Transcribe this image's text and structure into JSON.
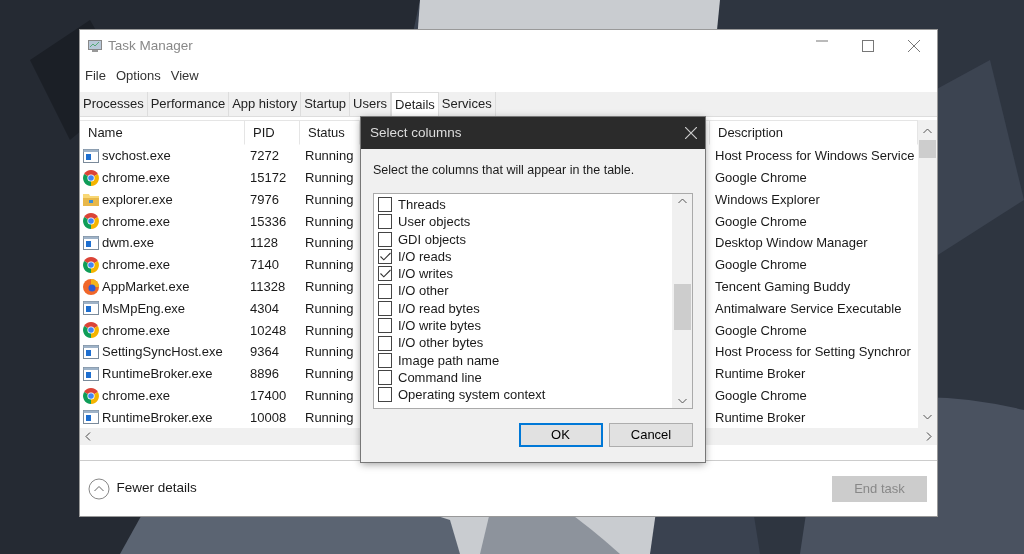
{
  "window": {
    "title": "Task Manager"
  },
  "menu": [
    "File",
    "Options",
    "View"
  ],
  "tabs": [
    {
      "label": "Processes",
      "selected": false
    },
    {
      "label": "Performance",
      "selected": false
    },
    {
      "label": "App history",
      "selected": false
    },
    {
      "label": "Startup",
      "selected": false
    },
    {
      "label": "Users",
      "selected": false
    },
    {
      "label": "Details",
      "selected": true
    },
    {
      "label": "Services",
      "selected": false
    }
  ],
  "table": {
    "columns": [
      "Name",
      "PID",
      "Status",
      "Description"
    ],
    "rows": [
      {
        "kind": "service",
        "name": "svchost.exe",
        "pid": "7272",
        "status": "Running",
        "description": "Host Process for Windows Service"
      },
      {
        "kind": "chrome",
        "name": "chrome.exe",
        "pid": "15172",
        "status": "Running",
        "description": "Google Chrome"
      },
      {
        "kind": "explorer",
        "name": "explorer.exe",
        "pid": "7976",
        "status": "Running",
        "description": "Windows Explorer"
      },
      {
        "kind": "chrome",
        "name": "chrome.exe",
        "pid": "15336",
        "status": "Running",
        "description": "Google Chrome"
      },
      {
        "kind": "service",
        "name": "dwm.exe",
        "pid": "1128",
        "status": "Running",
        "description": "Desktop Window Manager"
      },
      {
        "kind": "chrome",
        "name": "chrome.exe",
        "pid": "7140",
        "status": "Running",
        "description": "Google Chrome"
      },
      {
        "kind": "appmarket",
        "name": "AppMarket.exe",
        "pid": "11328",
        "status": "Running",
        "description": "Tencent Gaming Buddy"
      },
      {
        "kind": "service",
        "name": "MsMpEng.exe",
        "pid": "4304",
        "status": "Running",
        "description": "Antimalware Service Executable"
      },
      {
        "kind": "chrome",
        "name": "chrome.exe",
        "pid": "10248",
        "status": "Running",
        "description": "Google Chrome"
      },
      {
        "kind": "service",
        "name": "SettingSyncHost.exe",
        "pid": "9364",
        "status": "Running",
        "description": "Host Process for Setting Synchror"
      },
      {
        "kind": "service",
        "name": "RuntimeBroker.exe",
        "pid": "8896",
        "status": "Running",
        "description": "Runtime Broker"
      },
      {
        "kind": "chrome",
        "name": "chrome.exe",
        "pid": "17400",
        "status": "Running",
        "description": "Google Chrome"
      },
      {
        "kind": "service",
        "name": "RuntimeBroker.exe",
        "pid": "10008",
        "status": "Running",
        "description": "Runtime Broker"
      }
    ]
  },
  "footer": {
    "toggle": "Fewer details",
    "end_task": {
      "label": "End task",
      "disabled": true
    }
  },
  "dialog": {
    "title": "Select columns",
    "instruction": "Select the columns that will appear in the table.",
    "options": [
      {
        "label": "Threads",
        "checked": false
      },
      {
        "label": "User objects",
        "checked": false
      },
      {
        "label": "GDI objects",
        "checked": false
      },
      {
        "label": "I/O reads",
        "checked": true
      },
      {
        "label": "I/O writes",
        "checked": true
      },
      {
        "label": "I/O other",
        "checked": false
      },
      {
        "label": "I/O read bytes",
        "checked": false
      },
      {
        "label": "I/O write bytes",
        "checked": false
      },
      {
        "label": "I/O other bytes",
        "checked": false
      },
      {
        "label": "Image path name",
        "checked": false
      },
      {
        "label": "Command line",
        "checked": false
      },
      {
        "label": "Operating system context",
        "checked": false
      }
    ],
    "buttons": [
      {
        "label": "OK",
        "selected": true
      },
      {
        "label": "Cancel",
        "selected": false
      }
    ]
  }
}
